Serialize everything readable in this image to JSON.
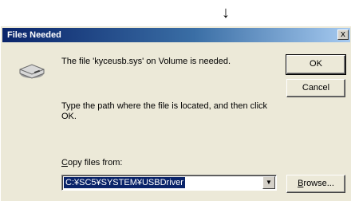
{
  "cursor": {
    "glyph": "↓"
  },
  "dialog": {
    "title": "Files Needed",
    "close_glyph": "x",
    "message": "The file 'kyceusb.sys' on Volume is needed.",
    "instruction": "Type the path where the file is located, and then click OK.",
    "copy_label_accel": "C",
    "copy_label_rest": "opy files from:",
    "path_value": "C:¥SC5¥SYSTEM¥USBDriver",
    "dropdown_glyph": "▼",
    "ok_label": "OK",
    "cancel_label": "Cancel",
    "browse_accel": "B",
    "browse_rest": "rowse..."
  },
  "colors": {
    "title_bar_start": "#0a246a",
    "title_bar_end": "#a6caf0",
    "dialog_face": "#ece9d8",
    "selection": "#0a246a"
  },
  "icons": {
    "file_icon": "disk-drive-icon"
  }
}
